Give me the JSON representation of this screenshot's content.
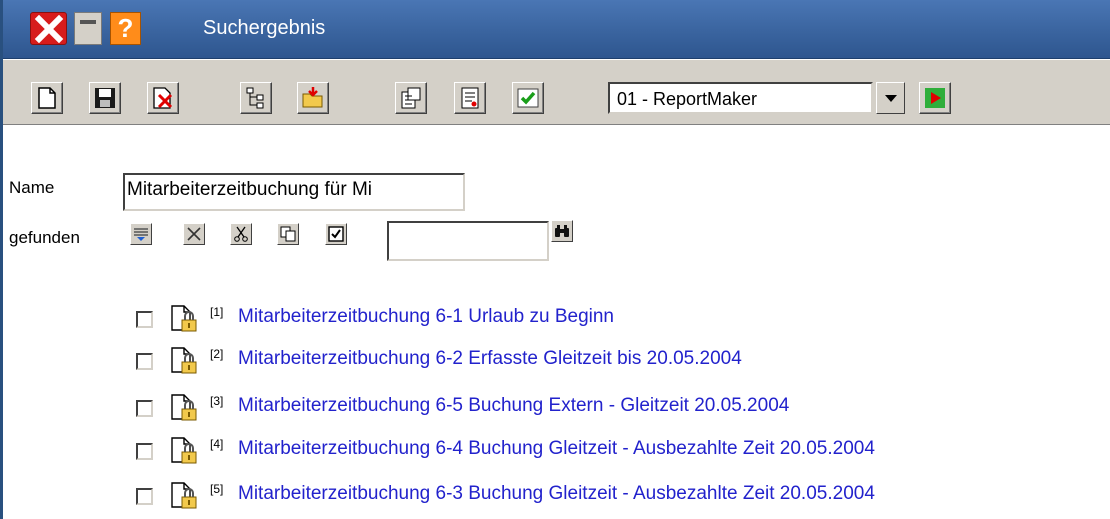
{
  "window": {
    "title": "Suchergebnis"
  },
  "titlebar_icons": [
    "close-icon",
    "minimize-icon",
    "help-icon"
  ],
  "toolbar": {
    "buttons": [
      "new-document-icon",
      "save-icon",
      "delete-icon",
      "tree-view-icon",
      "open-folder-icon",
      "properties-icon",
      "report-icon",
      "check-icon"
    ],
    "combo_value": "01 - ReportMaker",
    "run_icon": "play-icon"
  },
  "form": {
    "name_label": "Name",
    "name_value": "Mitarbeiterzeitbuchung für Mi",
    "found_label": "gefunden",
    "found_buttons": [
      "select-all-icon",
      "clear-icon",
      "cut-icon",
      "copy-icon",
      "checkbox-icon"
    ],
    "search_value": "",
    "find_icon": "binoculars-icon"
  },
  "results": [
    {
      "index": "[1]",
      "text": "Mitarbeiterzeitbuchung 6-1 Urlaub zu Beginn",
      "checked": false
    },
    {
      "index": "[2]",
      "text": "Mitarbeiterzeitbuchung 6-2 Erfasste Gleitzeit bis 20.05.2004",
      "checked": false
    },
    {
      "index": "[3]",
      "text": "Mitarbeiterzeitbuchung 6-5 Buchung Extern - Gleitzeit 20.05.2004",
      "checked": false
    },
    {
      "index": "[4]",
      "text": "Mitarbeiterzeitbuchung 6-4 Buchung Gleitzeit - Ausbezahlte Zeit 20.05.2004",
      "checked": false
    },
    {
      "index": "[5]",
      "text": "Mitarbeiterzeitbuchung 6-3 Buchung Gleitzeit - Ausbezahlte Zeit 20.05.2004",
      "checked": false
    }
  ],
  "colors": {
    "titlebar": "#3a649f",
    "link": "#2222cc",
    "toolbar": "#d4d0c8"
  }
}
